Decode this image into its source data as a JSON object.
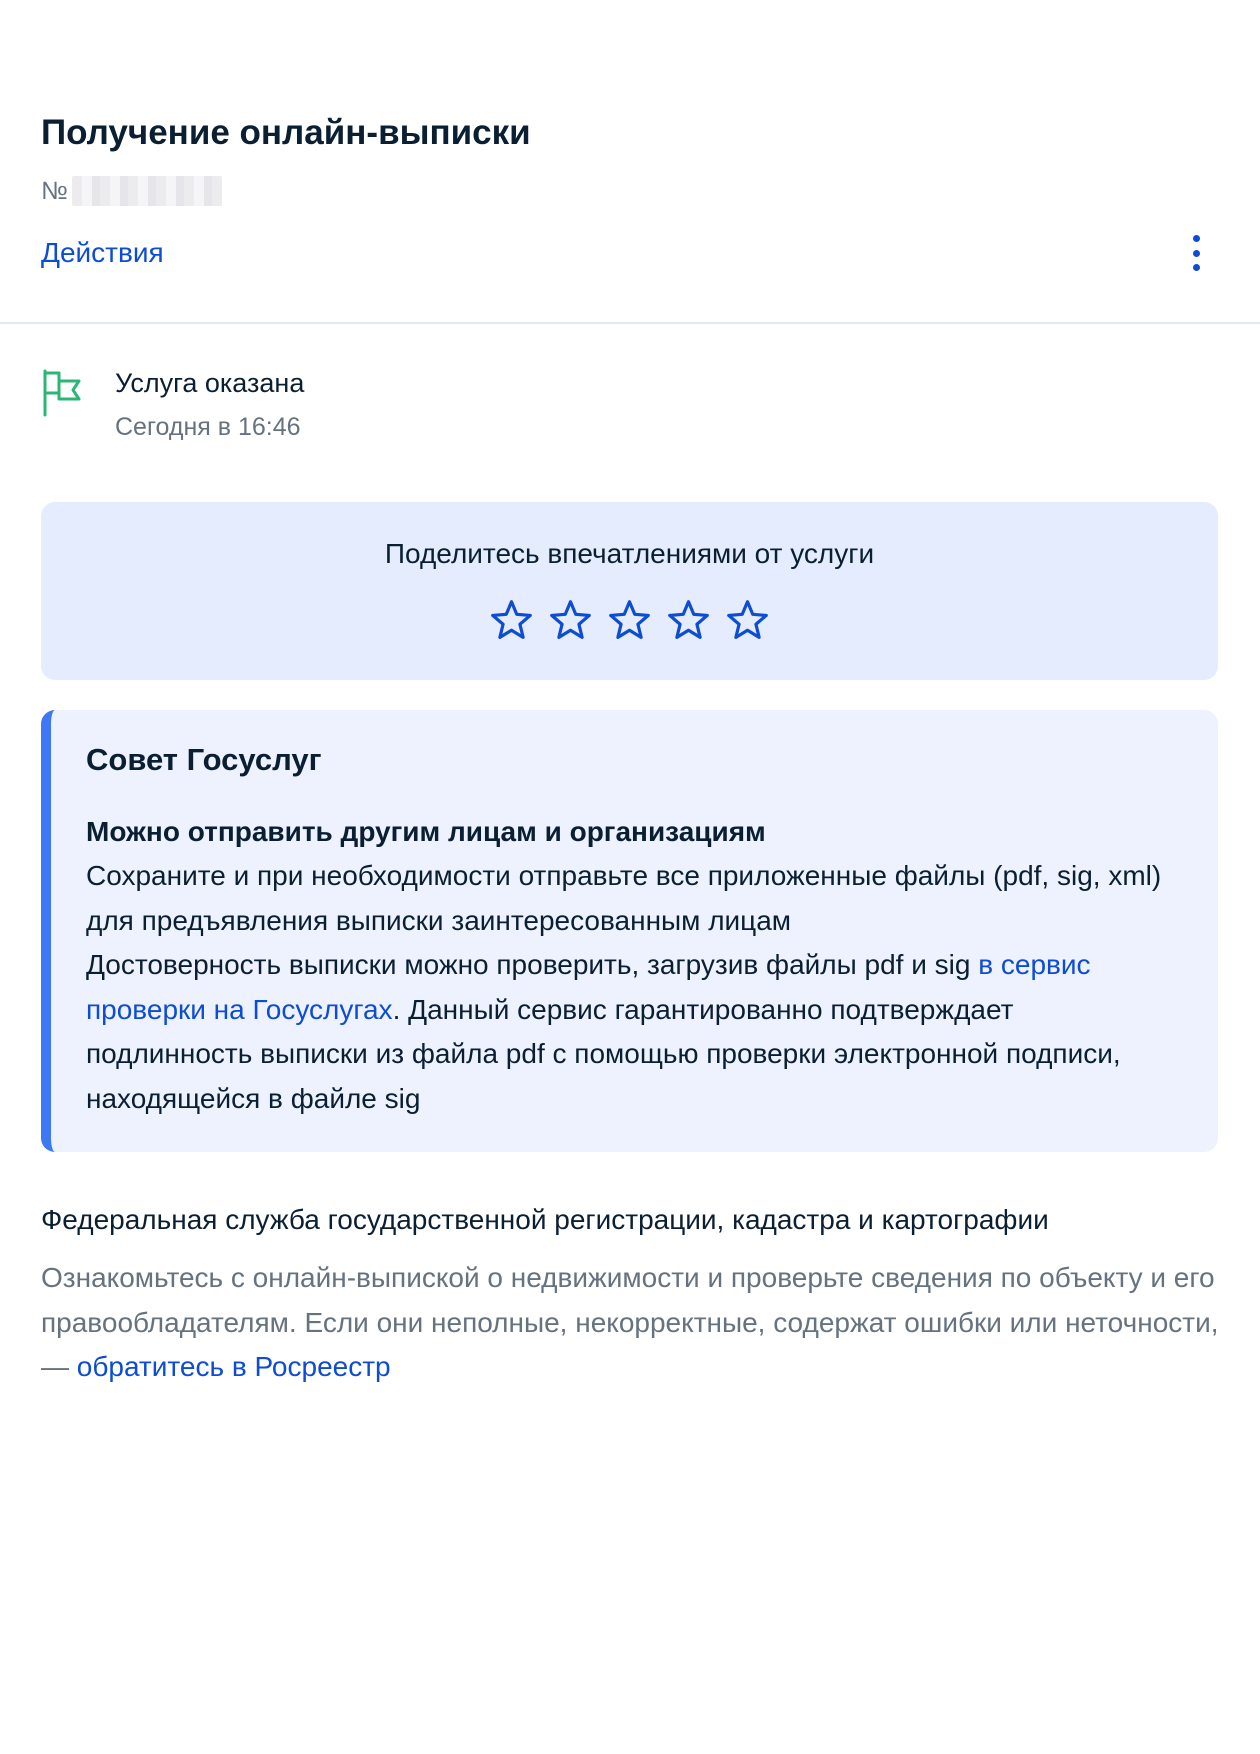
{
  "header": {
    "title": "Получение онлайн-выписки",
    "number_prefix": "№",
    "actions_label": "Действия"
  },
  "status": {
    "text": "Услуга оказана",
    "time": "Сегодня в 16:46"
  },
  "rating": {
    "title": "Поделитесь впечатлениями от услуги",
    "max_stars": 5,
    "selected": 0
  },
  "tip": {
    "title": "Совет Госуслуг",
    "subtitle": "Можно отправить другим лицам и организациям",
    "line1": "Сохраните и при необходимости отправьте все приложенные файлы (pdf, sig, xml) для предъявления выписки заинтересованным лицам",
    "line2_before": "Достоверность выписки можно проверить, загрузив файлы pdf и sig ",
    "line2_link": "в сервис проверки на Госуслугах",
    "line2_after": ". Данный сервис гарантированно подтверждает подлинность выписки из файла pdf с помощью проверки электронной подписи, находящейся в файле sig"
  },
  "org": {
    "title": "Федеральная служба государственной регистрации, кадастра и картографии",
    "desc_before": "Ознакомьтесь с онлайн-выпиской о недвижимости и проверьте сведения по объекту и его правообладателям. Если они неполные, некорректные, содержат ошибки или неточности, — ",
    "desc_link": "обратитесь в Росреестр"
  },
  "icons": {
    "status": "flag-icon",
    "menu": "kebab-menu-icon",
    "rating": "star-outline-icon"
  },
  "colors": {
    "link": "#0d4cd3",
    "flag": "#2bb673",
    "rating_bg": "#e4ecfd",
    "tip_bg": "#edf2fe",
    "tip_accent": "#3d78f5",
    "muted_text": "#66727f"
  }
}
